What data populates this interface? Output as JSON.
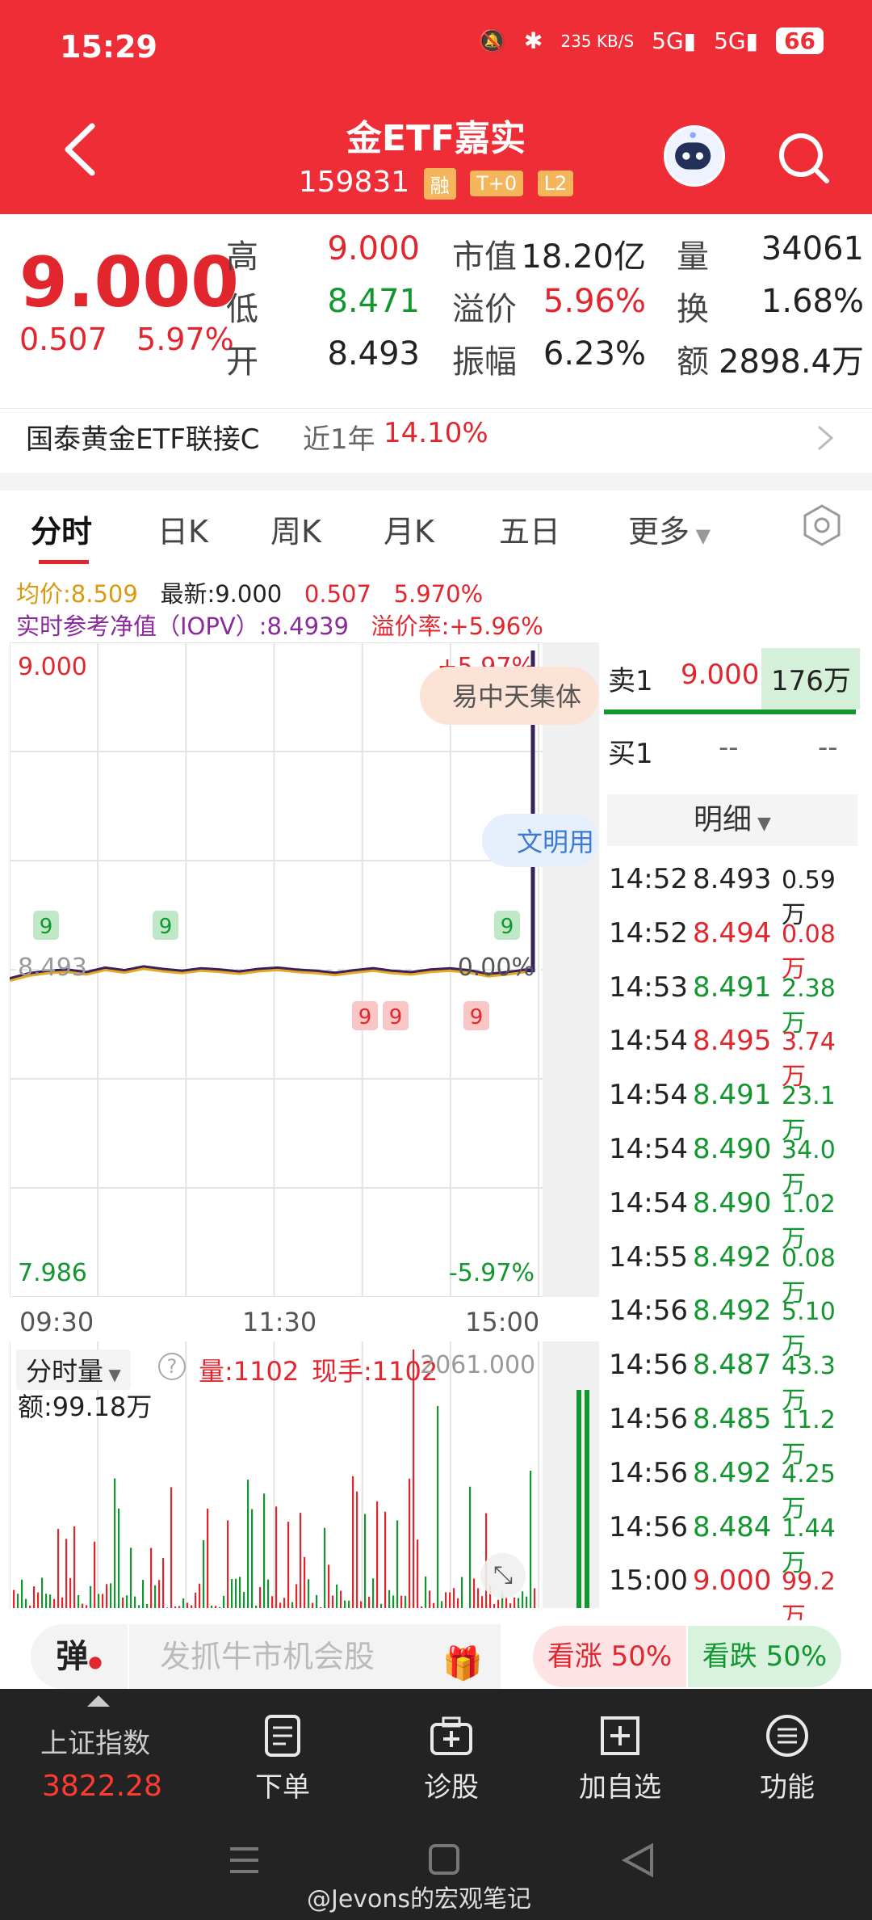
{
  "status_bar": {
    "time": "15:29",
    "net_speed": "235 KB/S",
    "signal1": "5G",
    "signal2": "5G",
    "battery": "66"
  },
  "header": {
    "title": "金ETF嘉实",
    "code": "159831",
    "tags": [
      "融",
      "T+0",
      "L2"
    ]
  },
  "quote": {
    "price": "9.000",
    "change": "0.507",
    "change_pct": "5.97%",
    "stats": [
      {
        "label": "高",
        "value": "9.000",
        "color": "red"
      },
      {
        "label": "市值",
        "value": "18.20亿",
        "color": "black"
      },
      {
        "label": "量",
        "value": "34061",
        "color": "black"
      },
      {
        "label": "低",
        "value": "8.471",
        "color": "green"
      },
      {
        "label": "溢价",
        "value": "5.96%",
        "color": "red"
      },
      {
        "label": "换",
        "value": "1.68%",
        "color": "black"
      },
      {
        "label": "开",
        "value": "8.493",
        "color": "black"
      },
      {
        "label": "振幅",
        "value": "6.23%",
        "color": "black"
      },
      {
        "label": "额",
        "value": "2898.4万",
        "color": "black"
      }
    ]
  },
  "fund_link": {
    "name": "国泰黄金ETF联接C",
    "period": "近1年",
    "return": "14.10%"
  },
  "tabs": [
    "分时",
    "日K",
    "周K",
    "月K",
    "五日",
    "更多"
  ],
  "chart_info": {
    "avg": "均价:8.509",
    "latest": "最新:9.000",
    "chg": "0.507",
    "pct": "5.970%",
    "iopv": "实时参考净值（IOPV）:8.4939",
    "premium": "溢价率:+5.96%"
  },
  "chart_data": {
    "type": "line",
    "y_top_label": "9.000",
    "y_mid_label": "8.493",
    "y_bottom_label": "7.986",
    "pct_top": "+5.97%",
    "pct_mid": "0.00%",
    "pct_bottom": "-5.97%",
    "x_labels": [
      "09:30",
      "11:30",
      "15:00"
    ],
    "ylim": [
      7.986,
      9.0
    ],
    "price_series": [
      8.478,
      8.486,
      8.49,
      8.492,
      8.488,
      8.495,
      8.491,
      8.497,
      8.493,
      8.49,
      8.494,
      8.492,
      8.489,
      8.493,
      8.495,
      8.492,
      8.49,
      8.487,
      8.491,
      8.494,
      8.49,
      8.488,
      8.492,
      8.494,
      8.491,
      8.485,
      8.488,
      8.492,
      9.0
    ],
    "markers_up": [
      "9",
      "9",
      "9"
    ],
    "markers_down": [
      "9",
      "9",
      "9"
    ],
    "banner1": "易中天集体",
    "banner2": "文明用"
  },
  "volume_panel": {
    "label": "分时量",
    "vol": "量:1102",
    "hand": "现手:1102",
    "max": "2061.000",
    "amount": "额:99.18万"
  },
  "order_book": {
    "sell1": {
      "label": "卖1",
      "price": "9.000",
      "vol": "176万"
    },
    "buy1": {
      "label": "买1",
      "price": "--",
      "vol": "--"
    },
    "detail_label": "明细"
  },
  "trades": [
    {
      "time": "14:52",
      "price": "8.493",
      "vol": "0.59万",
      "pc": "black"
    },
    {
      "time": "14:52",
      "price": "8.494",
      "vol": "0.08万",
      "pc": "red"
    },
    {
      "time": "14:53",
      "price": "8.491",
      "vol": "2.38万",
      "pc": "green"
    },
    {
      "time": "14:54",
      "price": "8.495",
      "vol": "3.74万",
      "pc": "red"
    },
    {
      "time": "14:54",
      "price": "8.491",
      "vol": "23.1万",
      "pc": "green"
    },
    {
      "time": "14:54",
      "price": "8.490",
      "vol": "34.0万",
      "pc": "green"
    },
    {
      "time": "14:54",
      "price": "8.490",
      "vol": "1.02万",
      "pc": "green"
    },
    {
      "time": "14:55",
      "price": "8.492",
      "vol": "0.08万",
      "pc": "green"
    },
    {
      "time": "14:56",
      "price": "8.492",
      "vol": "5.10万",
      "pc": "green"
    },
    {
      "time": "14:56",
      "price": "8.487",
      "vol": "43.3万",
      "pc": "green"
    },
    {
      "time": "14:56",
      "price": "8.485",
      "vol": "11.2万",
      "pc": "green"
    },
    {
      "time": "14:56",
      "price": "8.492",
      "vol": "4.25万",
      "pc": "green"
    },
    {
      "time": "14:56",
      "price": "8.484",
      "vol": "1.44万",
      "pc": "green"
    },
    {
      "time": "15:00",
      "price": "9.000",
      "vol": "99.2万",
      "pc": "red"
    }
  ],
  "promo": {
    "dan": "弹",
    "marquee": "发抓牛市机会股",
    "bull": "看涨 50%",
    "bear": "看跌 50%"
  },
  "bottom_nav": {
    "index_name": "上证指数",
    "index_value": "3822.28",
    "items": [
      "下单",
      "诊股",
      "加自选",
      "功能"
    ]
  },
  "watermark": "@Jevons的宏观笔记",
  "colors": {
    "brand_red": "#ee2d36",
    "up": "#e2262e",
    "down": "#12962f"
  }
}
